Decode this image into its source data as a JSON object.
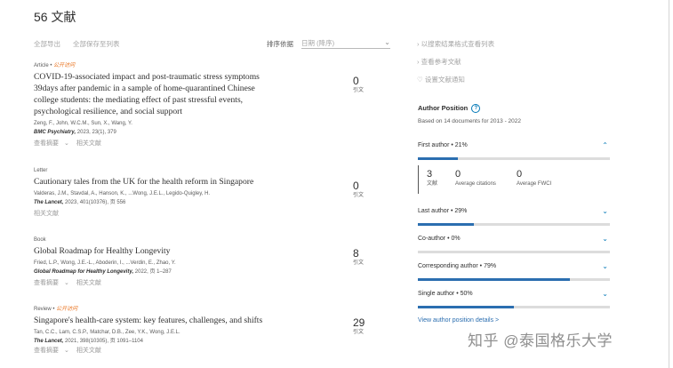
{
  "header": {
    "title": "56 文献"
  },
  "toolbar": {
    "export_all": "全部导出",
    "save_all": "全部保存至列表",
    "sort_label": "排序依据",
    "sort_value": "日期 (降序)"
  },
  "documents": [
    {
      "type": "Article",
      "access": "公开访问",
      "title": "COVID-19-associated impact and post-traumatic stress symptoms 39days after pandemic in a sample of home-quarantined Chinese college students: the mediating effect of past stressful events, psychological resilience, and social support",
      "authors": "Zeng, F., John, W.C.M., Sun, X., Wang, Y.",
      "source_name": "BMC Psychiatry,",
      "source_rest": " 2023, 23(1), 379",
      "action_abstract": "查看摘要",
      "action_related": "相关文献",
      "citations": "0",
      "citations_label": "引文"
    },
    {
      "type": "Letter",
      "access": "",
      "title": "Cautionary tales from the UK for the health reform in Singapore",
      "authors": "Valderas, J.M., Stavdal, A., Hanson, K., ...Wong, J.E.L., Legido-Quigley, H.",
      "source_name": "The Lancet,",
      "source_rest": " 2023, 401(10376), 页 556",
      "action_abstract": "",
      "action_related": "相关文献",
      "citations": "0",
      "citations_label": "引文"
    },
    {
      "type": "Book",
      "access": "",
      "title": "Global Roadmap for Healthy Longevity",
      "authors": "Fried, L.P., Wong, J.E.-L., Aboderin, I., ...Verdin, E., Zhao, Y.",
      "source_name": "Global Roadmap for Healthy Longevity,",
      "source_rest": " 2022, 页 1–287",
      "action_abstract": "查看摘要",
      "action_related": "相关文献",
      "citations": "8",
      "citations_label": "引文"
    },
    {
      "type": "Review",
      "access": "公开访问",
      "title": "Singapore's health-care system: key features, challenges, and shifts",
      "authors": "Tan, C.C., Lam, C.S.P., Matchar, D.B., Zee, Y.K., Wong, J.E.L.",
      "source_name": "The Lancet,",
      "source_rest": " 2021, 398(10305), 页 1091–1104",
      "action_abstract": "查看摘要",
      "action_related": "相关文献",
      "citations": "29",
      "citations_label": "引文"
    }
  ],
  "right_links": {
    "view_list": "以搜索结果格式查看列表",
    "view_refs": "查看参考文献",
    "alert": "设置文献通知"
  },
  "author_position": {
    "title": "Author Position",
    "subtitle": "Based on 14 documents for 2013 - 2022",
    "first_author": {
      "label": "First author",
      "pct_text": "21%",
      "fraction": 0.21
    },
    "stats": {
      "docs": "3",
      "docs_label": "文献",
      "citations": "0",
      "citations_label": "Average citations",
      "fwci": "0",
      "fwci_label": "Average FWCI"
    },
    "last_author": {
      "label": "Last author",
      "pct_text": "29%",
      "fraction": 0.29
    },
    "co_author": {
      "label": "Co-author",
      "pct_text": "0%",
      "fraction": 0.0
    },
    "corresponding_author": {
      "label": "Corresponding author",
      "pct_text": "79%",
      "fraction": 0.79
    },
    "single_author": {
      "label": "Single author",
      "pct_text": "50%",
      "fraction": 0.5
    },
    "details_link": "View author position details >"
  },
  "watermark": "知乎 @泰国格乐大学",
  "colors": {
    "accent": "#2b6eb0",
    "open_access": "#e9711c"
  }
}
